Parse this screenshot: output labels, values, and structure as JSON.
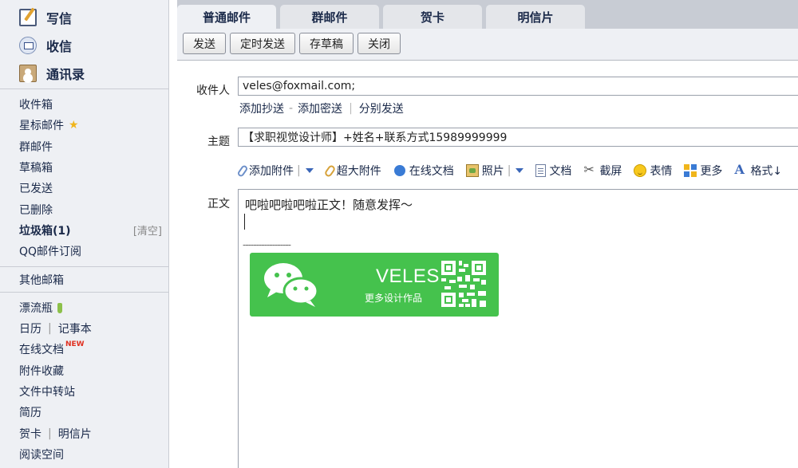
{
  "sidebar": {
    "top_actions": [
      {
        "label": "写信",
        "icon": "write-icon"
      },
      {
        "label": "收信",
        "icon": "inbox-icon"
      },
      {
        "label": "通讯录",
        "icon": "contacts-icon"
      }
    ],
    "folders": {
      "inbox": "收件箱",
      "starred": "星标邮件",
      "group": "群邮件",
      "drafts": "草稿箱",
      "sent": "已发送",
      "deleted": "已删除",
      "trash": "垃圾箱(1)",
      "trash_clear": "[清空]",
      "qq_subscribe": "QQ邮件订阅"
    },
    "other": {
      "other_mailbox": "其他邮箱"
    },
    "apps": {
      "drift_bottle": "漂流瓶",
      "calendar": "日历",
      "notes": "记事本",
      "online_docs": "在线文档",
      "new_badge": "NEW",
      "attachment_fav": "附件收藏",
      "file_transfer": "文件中转站",
      "resume": "简历",
      "greeting_card": "贺卡",
      "postcard": "明信片",
      "reading_space": "阅读空间"
    }
  },
  "tabs": [
    "普通邮件",
    "群邮件",
    "贺卡",
    "明信片"
  ],
  "toolbar": {
    "send": "发送",
    "scheduled_send": "定时发送",
    "save_draft": "存草稿",
    "close": "关闭"
  },
  "compose": {
    "to_label": "收件人",
    "to_value": "veles@foxmail.com;",
    "add_cc": "添加抄送",
    "add_bcc": "添加密送",
    "separate_send": "分别发送",
    "subject_label": "主题",
    "subject_value": "【求职视觉设计师】+姓名+联系方式15989999999",
    "body_label": "正文",
    "body_text": "吧啦吧啦吧啦正文！随意发挥～",
    "signature_divider": "------------------"
  },
  "editor_tools": {
    "add_attachment": "添加附件",
    "large_attachment": "超大附件",
    "online_doc": "在线文档",
    "photo": "照片",
    "document": "文档",
    "screenshot": "截屏",
    "emoji": "表情",
    "more": "更多",
    "format": "格式↓"
  },
  "signature": {
    "name": "VELES",
    "subtitle": "更多设计作品",
    "bg_color": "#45c24d"
  }
}
